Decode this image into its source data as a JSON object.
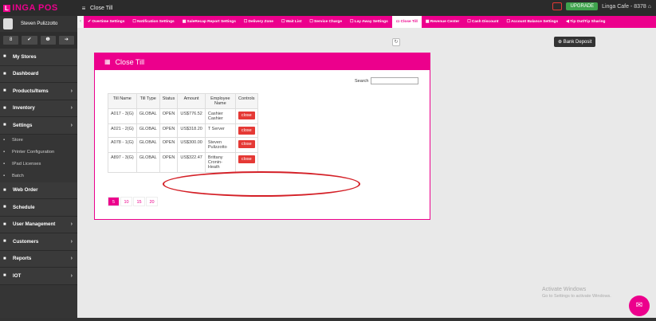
{
  "app": {
    "logo_mark": "L",
    "logo_text": "INGA POS",
    "page_title": "Close Till",
    "upgrade_label": "UPGRADE",
    "store_name": "Linga Cafe - 8378"
  },
  "user": {
    "name": "Steven Pulizzotto"
  },
  "quick_buttons": [
    "8",
    "✔",
    "❶",
    "➔"
  ],
  "sidebar": {
    "items": [
      {
        "label": "My Stores",
        "icon": "store-icon",
        "chevron": false
      },
      {
        "label": "Dashboard",
        "icon": "dashboard-icon",
        "chevron": false
      },
      {
        "label": "Products/Items",
        "icon": "products-icon",
        "chevron": true
      },
      {
        "label": "Inventory",
        "icon": "inventory-icon",
        "chevron": true
      },
      {
        "label": "Settings",
        "icon": "settings-icon",
        "chevron": true
      }
    ],
    "sub_items": [
      {
        "label": "Store",
        "icon": "store-sub-icon"
      },
      {
        "label": "Printer Configuration",
        "icon": "printer-icon"
      },
      {
        "label": "IPad Licenses",
        "icon": "key-icon"
      },
      {
        "label": "Batch",
        "icon": "batch-icon"
      }
    ],
    "items2": [
      {
        "label": "Web Order",
        "icon": "web-order-icon",
        "chevron": false
      },
      {
        "label": "Schedule",
        "icon": "schedule-icon",
        "chevron": false
      },
      {
        "label": "User Management",
        "icon": "users-icon",
        "chevron": true
      },
      {
        "label": "Customers",
        "icon": "customers-icon",
        "chevron": true
      },
      {
        "label": "Reports",
        "icon": "reports-icon",
        "chevron": true
      },
      {
        "label": "IOT",
        "icon": "iot-icon",
        "chevron": true
      }
    ]
  },
  "tabs": [
    "✔ Overtime Settings",
    "☐ Notification Settings",
    "▦ SaleRecap Report Settings",
    "☐ Delivery Zone",
    "☐ Wait List",
    "☐ Service Charge",
    "☐ Lay Away Settings",
    "▭ Close Till",
    "▦ Revenue Center",
    "☐ Cash Discount",
    "☐ Account Balance Settings",
    "◀ Tip Out/Tip Sharing"
  ],
  "active_tab": 7,
  "bank_deposit_label": "Bank Deposit",
  "panel": {
    "title": "Close Till",
    "search_label": "Search"
  },
  "table": {
    "headers": [
      "Till Name",
      "Till Type",
      "Status",
      "Amount",
      "Employee Name",
      "Controls"
    ],
    "rows": [
      {
        "name": "A017 - 3(G)",
        "type": "GLOBAL",
        "status": "OPEN",
        "amount": "US$776.52",
        "employee": "Cashier Cashier",
        "control": "close"
      },
      {
        "name": "A021 - 2(G)",
        "type": "GLOBAL",
        "status": "OPEN",
        "amount": "US$318.20",
        "employee": "T Server",
        "control": "close"
      },
      {
        "name": "A078 - 1(G)",
        "type": "GLOBAL",
        "status": "OPEN",
        "amount": "US$300.00",
        "employee": "Steven Pulizzotto",
        "control": "close"
      },
      {
        "name": "A897 - 3(G)",
        "type": "GLOBAL",
        "status": "OPEN",
        "amount": "US$322.47",
        "employee": "Brittany Cronin-Heath",
        "control": "close"
      }
    ]
  },
  "pagination": [
    "5",
    "10",
    "15",
    "20"
  ],
  "watermark": {
    "title": "Activate Windows",
    "subtitle": "Go to Settings to activate Windows."
  },
  "colors": {
    "brand": "#ec008c",
    "danger": "#e53935",
    "sidebar": "#353535"
  }
}
